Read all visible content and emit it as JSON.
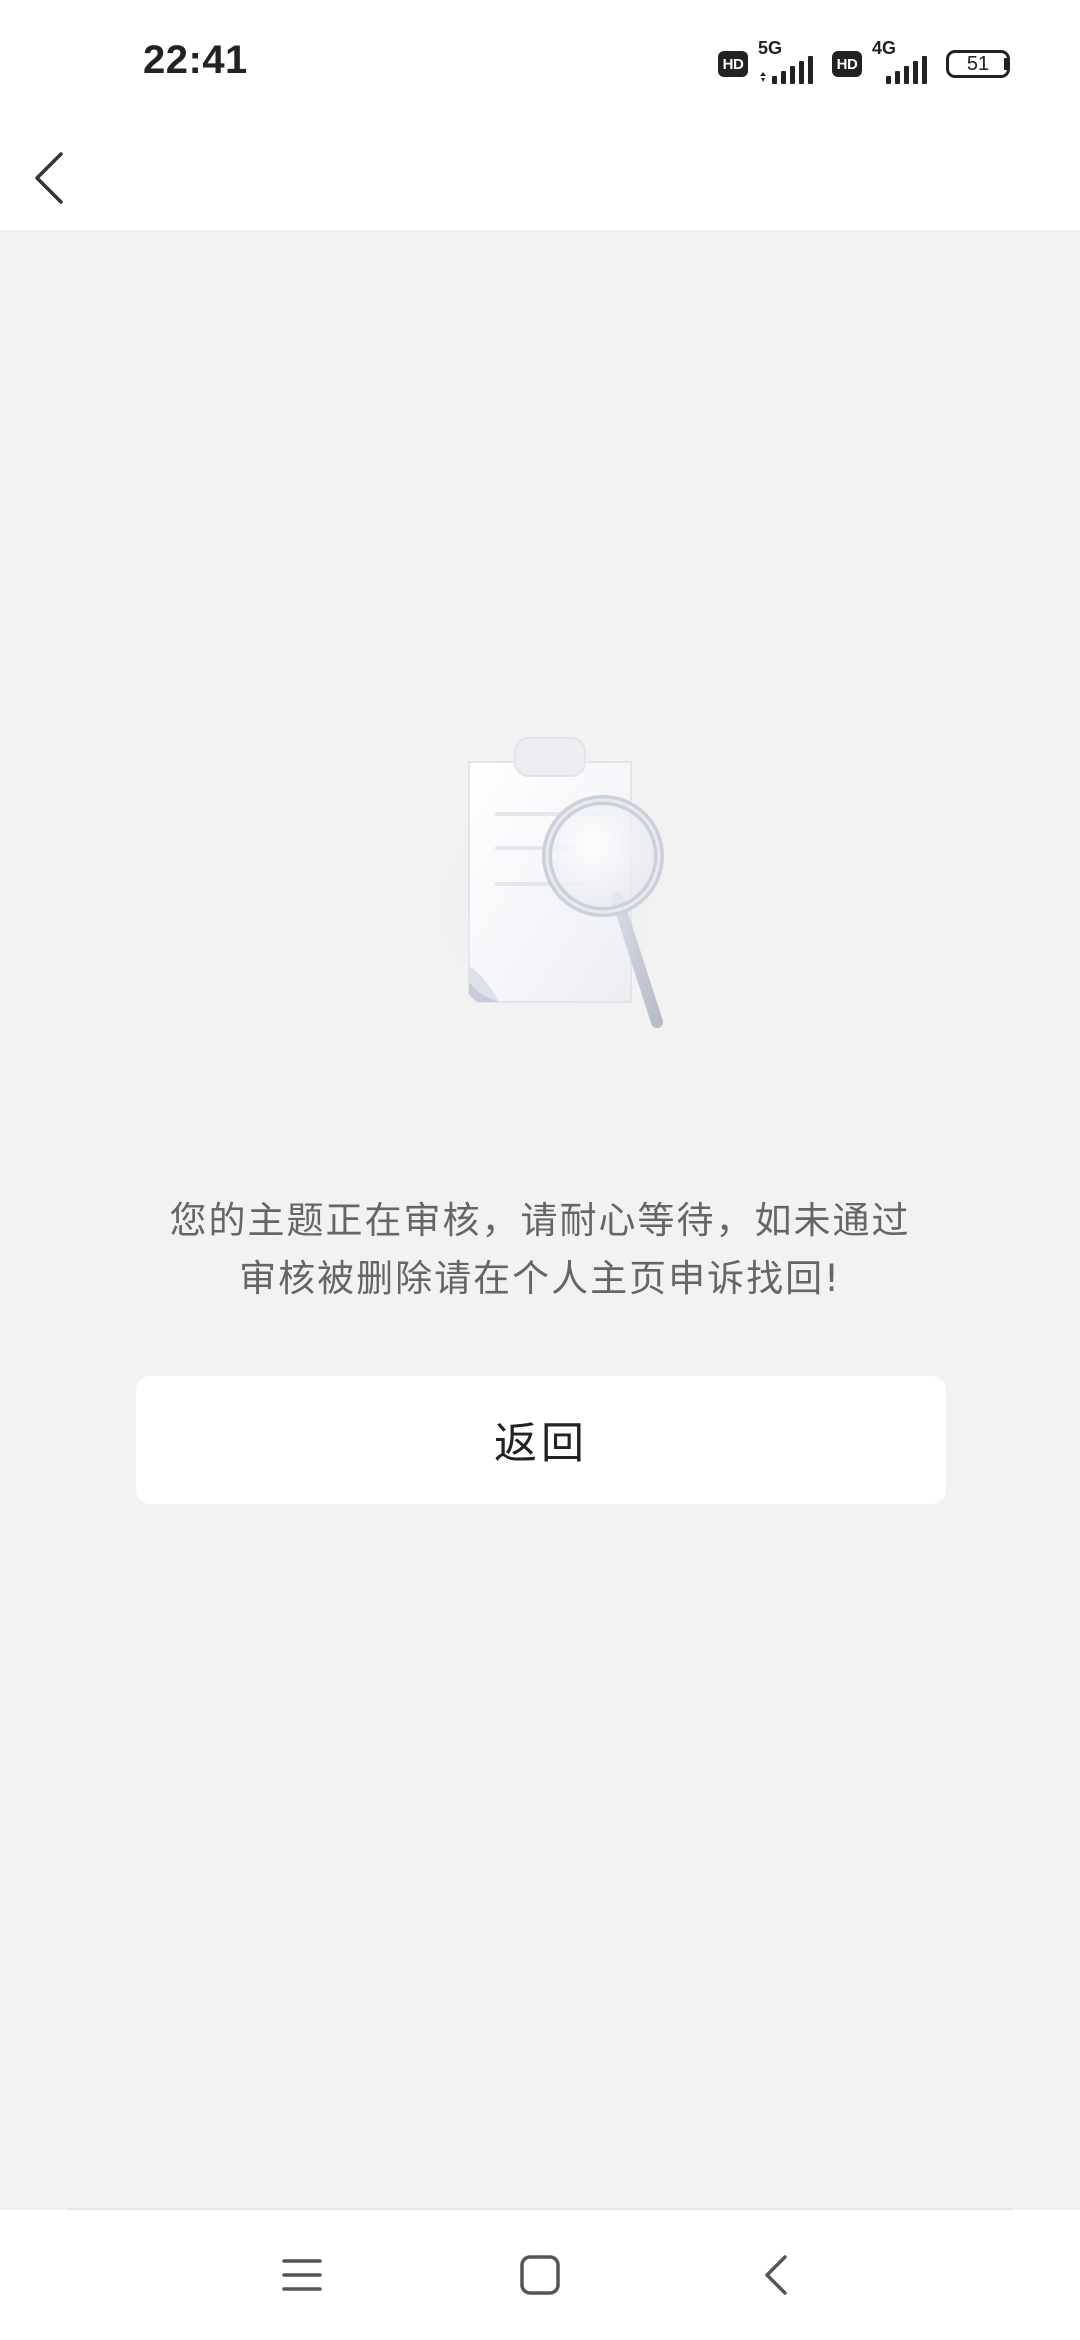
{
  "status_bar": {
    "time": "22:41",
    "hd_label_1": "HD",
    "network_1": "5G",
    "hd_label_2": "HD",
    "network_2": "4G",
    "battery": "51"
  },
  "top_nav": {
    "back_icon": "chevron-left-icon"
  },
  "illustration": {
    "icon": "document-search-icon"
  },
  "message": {
    "line_1": "您的主题正在审核，请耐心等待，如未通过",
    "line_2": "审核被删除请在个人主页申诉找回!"
  },
  "return_button": {
    "label": "返回"
  },
  "system_nav": {
    "menu_icon": "menu-icon",
    "home_icon": "home-square-icon",
    "back_icon": "back-triangle-icon"
  },
  "colors": {
    "page_background": "#f2f2f3",
    "surface": "#ffffff",
    "message_text": "#666666",
    "primary_text": "#222222"
  }
}
